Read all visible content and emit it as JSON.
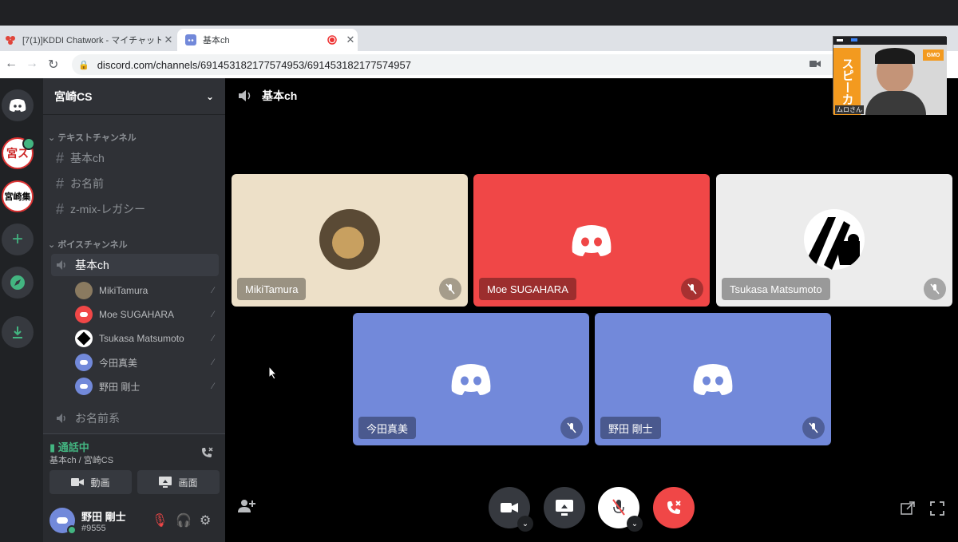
{
  "browser": {
    "tabs": [
      {
        "title": "[7(1)]KDDI Chatwork - マイチャット",
        "close": "✕"
      },
      {
        "title": "基本ch",
        "close": "✕"
      }
    ],
    "new_tab": "+",
    "url": "discord.com/channels/691453182177574953/691453182177574957"
  },
  "guild": {
    "name": "宮崎CS"
  },
  "servers": [
    {
      "name": "home-icon"
    },
    {
      "name": "宮ス"
    },
    {
      "name": "宮崎集"
    }
  ],
  "categories": {
    "text": "テキストチャンネル",
    "voice": "ボイスチャンネル"
  },
  "text_channels": [
    "基本ch",
    "お名前",
    "z-mix-レガシー"
  ],
  "voice_channels": [
    "基本ch",
    "お名前系"
  ],
  "voice_users": [
    "MikiTamura",
    "Moe SUGAHARA",
    "Tsukasa Matsumoto",
    "今田真美",
    "野田 剛士"
  ],
  "voice_status": {
    "title": "通話中",
    "subtitle": "基本ch / 宮崎CS",
    "video_button": "動画",
    "screen_button": "画面"
  },
  "user": {
    "name": "野田 剛士",
    "tag": "#9555"
  },
  "call": {
    "channel_title": "基本ch",
    "participants": [
      {
        "name": "MikiTamura",
        "bg": "#ede0c8"
      },
      {
        "name": "Moe SUGAHARA",
        "bg": "#f04747"
      },
      {
        "name": "Tsukasa Matsumoto",
        "bg": "#ececec"
      },
      {
        "name": "今田真美",
        "bg": "#7289da"
      },
      {
        "name": "野田 剛士",
        "bg": "#7289da"
      }
    ]
  },
  "pip": {
    "sign": "スピーカ",
    "caption": "ムロさん",
    "logo": "GMO"
  },
  "colors": {
    "blurple": "#7289da",
    "red": "#f04747",
    "green": "#43b581"
  }
}
